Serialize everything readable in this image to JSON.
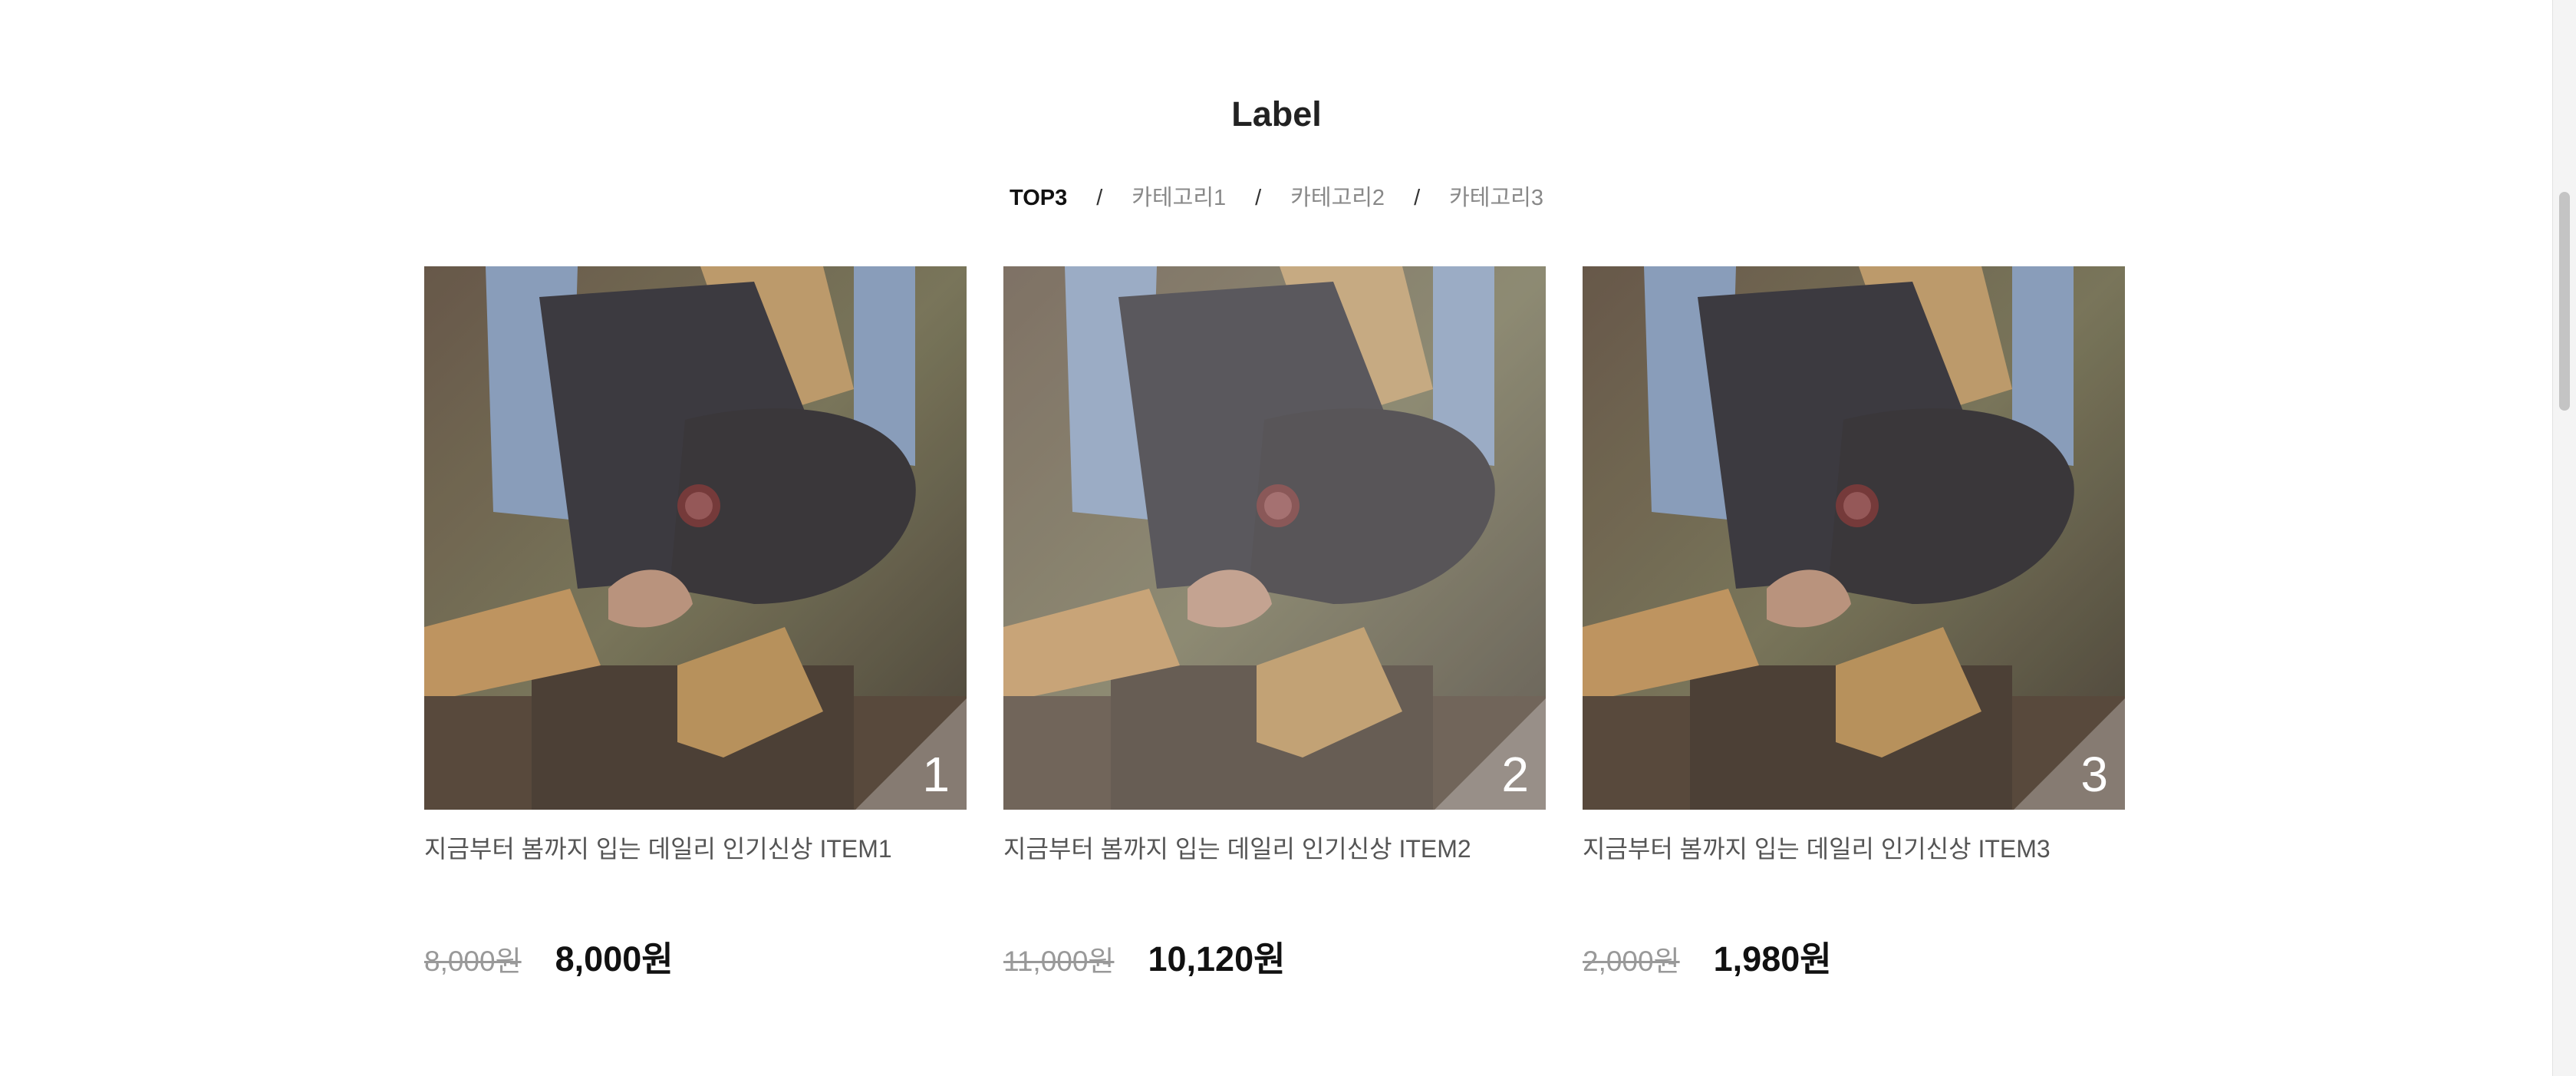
{
  "section": {
    "title": "Label"
  },
  "tabs": [
    {
      "label": "TOP3",
      "active": true
    },
    {
      "label": "카테고리1",
      "active": false
    },
    {
      "label": "카테고리2",
      "active": false
    },
    {
      "label": "카테고리3",
      "active": false
    }
  ],
  "tab_separator": "/",
  "products": [
    {
      "rank": "1",
      "title": "지금부터 봄까지 입는 데일리 인기신상 ITEM1",
      "original_price": "8,000원",
      "sale_price": "8,000원"
    },
    {
      "rank": "2",
      "title": "지금부터 봄까지 입는 데일리 인기신상 ITEM2",
      "original_price": "11,000원",
      "sale_price": "10,120원"
    },
    {
      "rank": "3",
      "title": "지금부터 봄까지 입는 데일리 인기신상 ITEM3",
      "original_price": "2,000원",
      "sale_price": "1,980원"
    }
  ],
  "colors": {
    "active_tab": "#111111",
    "inactive_tab": "#888888",
    "strike_price": "#999999"
  }
}
